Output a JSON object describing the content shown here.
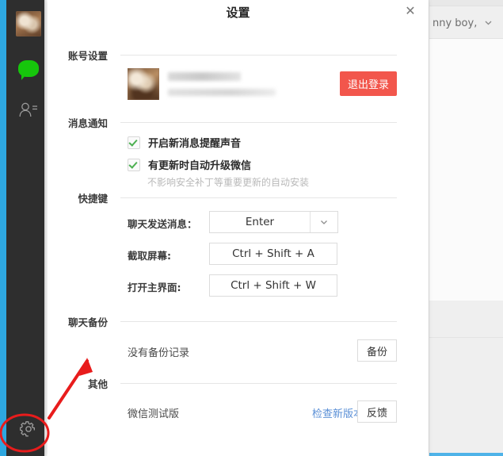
{
  "dialog": {
    "title": "设置",
    "close_icon": "close-icon"
  },
  "sidebar": {
    "avatar": "user-avatar-thumbnail",
    "items": [
      {
        "icon": "chat-bubble-icon",
        "name": "chat"
      },
      {
        "icon": "contacts-icon",
        "name": "contacts"
      },
      {
        "icon": "gear-icon",
        "name": "settings"
      }
    ]
  },
  "background_window": {
    "user_label": "nny boy,",
    "chevron_icon": "chevron-down-icon"
  },
  "sections": {
    "account": {
      "label": "账号设置",
      "logout_button": "退出登录"
    },
    "notifications": {
      "label": "消息通知",
      "checkboxes": [
        {
          "text": "开启新消息提醒声音",
          "checked": true,
          "sub": ""
        },
        {
          "text": "有更新时自动升级微信",
          "checked": true,
          "sub": "不影响安全补丁等重要更新的自动安装"
        }
      ]
    },
    "shortcuts": {
      "label": "快捷键",
      "rows": [
        {
          "label": "聊天发送消息：",
          "value": "Enter",
          "type": "select",
          "arrow_icon": "chevron-down-icon"
        },
        {
          "label": "截取屏幕:",
          "value": "Ctrl + Shift + A",
          "type": "field"
        },
        {
          "label": "打开主界面:",
          "value": "Ctrl + Shift + W",
          "type": "field"
        }
      ]
    },
    "backup": {
      "label": "聊天备份",
      "status": "没有备份记录",
      "button": "备份"
    },
    "other": {
      "label": "其他",
      "version": "微信测试版",
      "check_update_link": "检查新版本",
      "feedback_button": "反馈"
    }
  },
  "annotation": {
    "highlight_target": "settings-gear-icon",
    "color": "#e81c1c",
    "shapes": [
      "ellipse",
      "arrow"
    ]
  },
  "colors": {
    "sidebar_bg": "#2e2e2e",
    "accent_blue": "#2ea7e0",
    "logout_red": "#f2564c",
    "link_blue": "#5a8fd6",
    "check_green": "#4caf50",
    "annotation_red": "#e81c1c"
  }
}
